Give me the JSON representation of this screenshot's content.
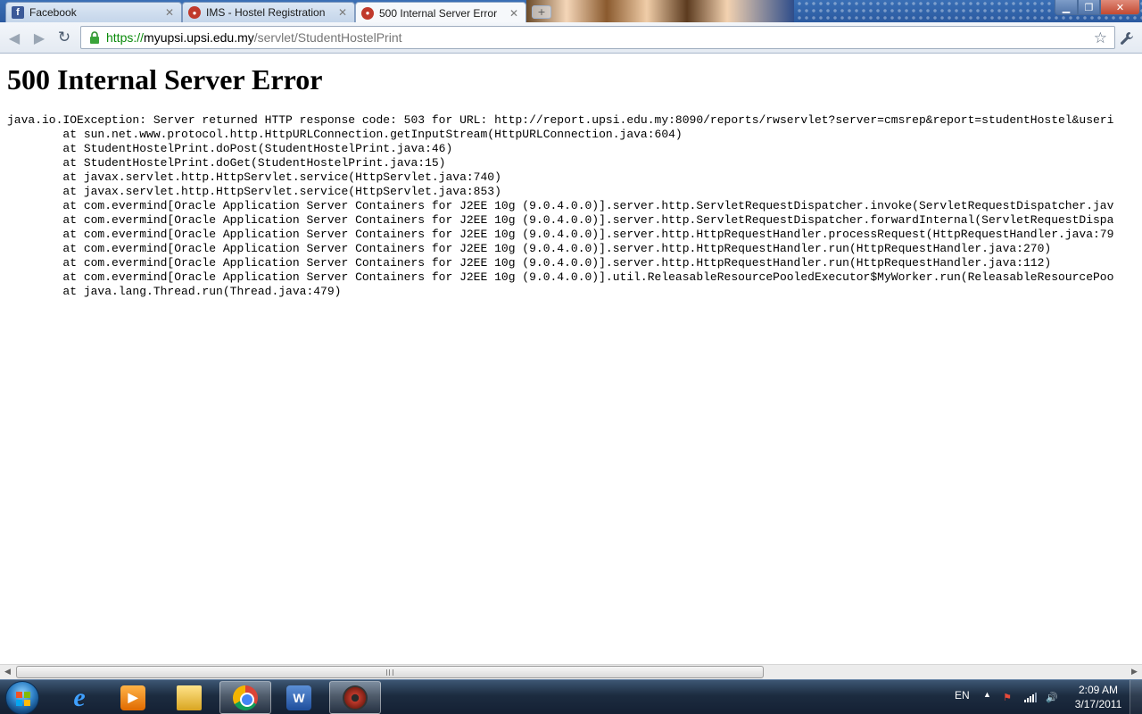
{
  "browser": {
    "tabs": [
      {
        "title": "Facebook",
        "favicon": "facebook-icon",
        "active": false
      },
      {
        "title": "IMS - Hostel Registration",
        "favicon": "upsi-icon",
        "active": false
      },
      {
        "title": "500 Internal Server Error",
        "favicon": "upsi-icon",
        "active": true
      }
    ],
    "url": {
      "scheme": "https://",
      "host": "myupsi.upsi.edu.my",
      "path": "/servlet/StudentHostelPrint"
    },
    "icons": [
      "back-icon",
      "forward-icon",
      "reload-icon",
      "lock-icon",
      "star-icon",
      "wrench-icon"
    ]
  },
  "page": {
    "heading": "500 Internal Server Error",
    "stack_trace": [
      "java.io.IOException: Server returned HTTP response code: 503 for URL: http://report.upsi.edu.my:8090/reports/rwservlet?server=cmsrep&report=studentHostel&useri",
      "        at sun.net.www.protocol.http.HttpURLConnection.getInputStream(HttpURLConnection.java:604)",
      "        at StudentHostelPrint.doPost(StudentHostelPrint.java:46)",
      "        at StudentHostelPrint.doGet(StudentHostelPrint.java:15)",
      "        at javax.servlet.http.HttpServlet.service(HttpServlet.java:740)",
      "        at javax.servlet.http.HttpServlet.service(HttpServlet.java:853)",
      "        at com.evermind[Oracle Application Server Containers for J2EE 10g (9.0.4.0.0)].server.http.ServletRequestDispatcher.invoke(ServletRequestDispatcher.jav",
      "        at com.evermind[Oracle Application Server Containers for J2EE 10g (9.0.4.0.0)].server.http.ServletRequestDispatcher.forwardInternal(ServletRequestDispa",
      "        at com.evermind[Oracle Application Server Containers for J2EE 10g (9.0.4.0.0)].server.http.HttpRequestHandler.processRequest(HttpRequestHandler.java:79",
      "        at com.evermind[Oracle Application Server Containers for J2EE 10g (9.0.4.0.0)].server.http.HttpRequestHandler.run(HttpRequestHandler.java:270)",
      "        at com.evermind[Oracle Application Server Containers for J2EE 10g (9.0.4.0.0)].server.http.HttpRequestHandler.run(HttpRequestHandler.java:112)",
      "        at com.evermind[Oracle Application Server Containers for J2EE 10g (9.0.4.0.0)].util.ReleasableResourcePooledExecutor$MyWorker.run(ReleasableResourcePoo",
      "        at java.lang.Thread.run(Thread.java:479)"
    ]
  },
  "taskbar": {
    "apps": [
      {
        "name": "internet-explorer-icon",
        "active": false
      },
      {
        "name": "media-player-icon",
        "active": false
      },
      {
        "name": "file-explorer-icon",
        "active": false
      },
      {
        "name": "chrome-icon",
        "active": true
      },
      {
        "name": "word-icon",
        "active": false
      },
      {
        "name": "dvd-player-icon",
        "active": false
      }
    ],
    "tray": {
      "language": "EN",
      "icons": [
        "show-hidden-icons-icon",
        "action-center-icon",
        "network-icon",
        "volume-icon"
      ]
    },
    "clock": {
      "time": "2:09 AM",
      "date": "3/17/2011"
    }
  },
  "colors": {
    "url_scheme": "#0a8a0a",
    "url_path": "#767676",
    "taskbar": "#1c2c40",
    "tabstrip": "#2b5aa0"
  }
}
